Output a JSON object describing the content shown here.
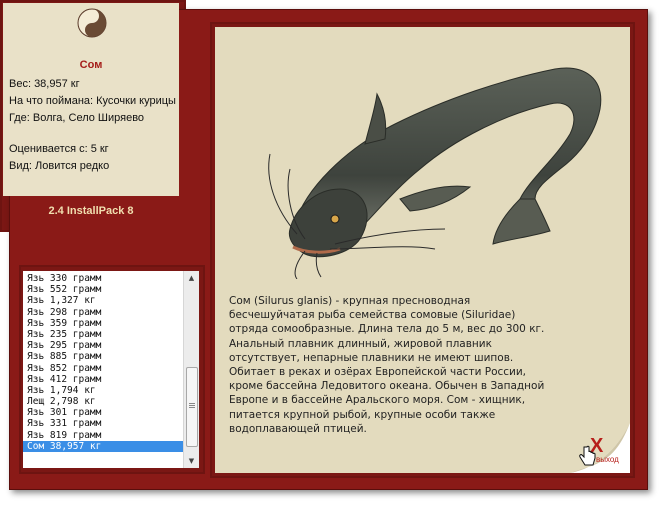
{
  "fish_info": {
    "name": "Сом",
    "weight": "Вес: 38,957 кг",
    "bait": "На что поймана: Кусочки курицы",
    "location": "Где: Волга, Село Ширяево",
    "value": "Оценивается с: 5 кг",
    "rarity": "Вид: Ловится редко",
    "logo_icon": "yin-yang-butterfly-icon"
  },
  "version": "2.4 InstallPack 8",
  "catch_list": [
    "Язь 330 грамм",
    "Язь 552 грамм",
    "Язь 1,327 кг",
    "Язь 298 грамм",
    "Язь 359 грамм",
    "Язь 235 грамм",
    "Язь 295 грамм",
    "Язь 885 грамм",
    "Язь 852 грамм",
    "Язь 412 грамм",
    "Язь 1,794 кг",
    "Лещ 2,798 кг",
    "Язь 301 грамм",
    "Язь 331 грамм",
    "Язь 819 грамм",
    "Сом 38,957 кг"
  ],
  "selected_index": 15,
  "description": "Сом (Silurus glanis) - крупная пресноводная бесчешуйчатая рыба семейства сомовые (Siluridae) отряда сомообразные. Длина тела до 5 м, вес до 300 кг. Анальный плавник длинный, жировой плавник отсутствует, непарные плавники не имеют шипов. Обитает в реках и озёрах Европейской части России, кроме бассейна Ледовитого океана. Обычен в Западной Европе и в бассейне Аральского моря. Сом - хищник, питается крупной рыбой, крупные особи также водоплавающей птицей.",
  "exit": {
    "symbol": "X",
    "label": "выход"
  },
  "colors": {
    "frame": "#8a1a17",
    "parchment": "#e9e1c8",
    "accent": "#a51d1a",
    "selection": "#3a8ee6"
  }
}
